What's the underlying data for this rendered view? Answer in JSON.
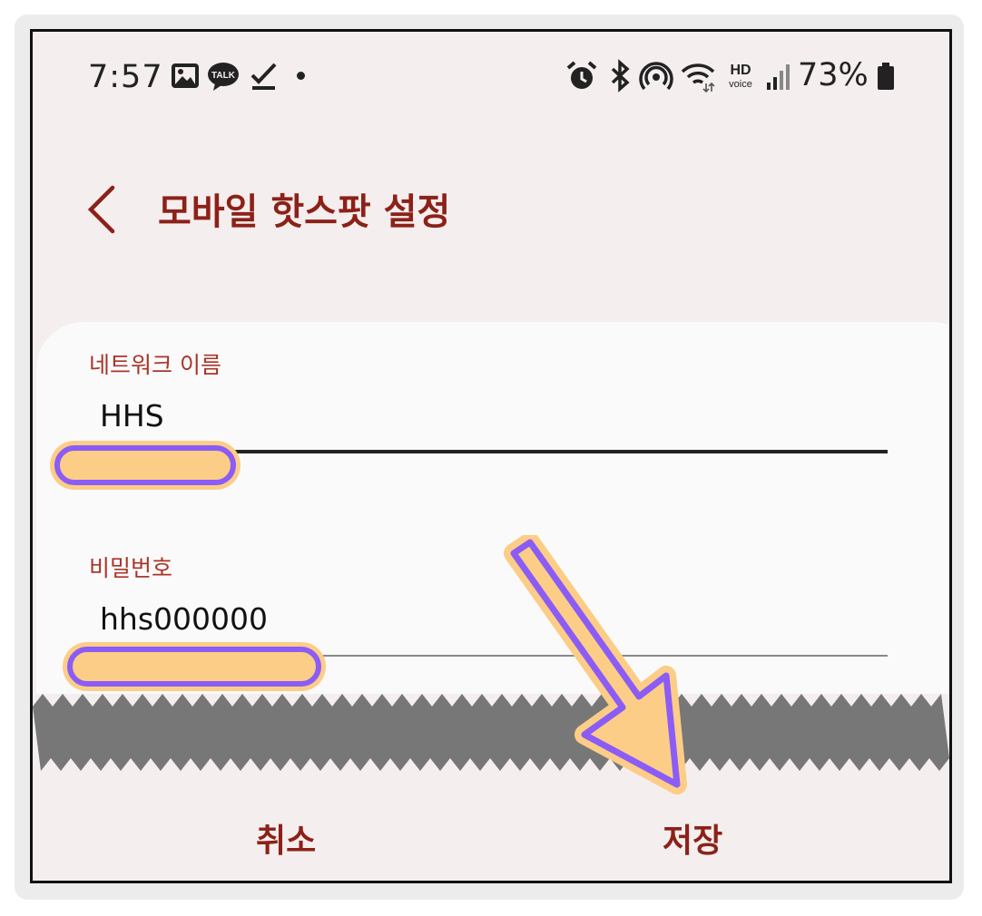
{
  "status_bar": {
    "time": "7:57",
    "notification_icons": [
      "gallery-icon",
      "kakaotalk-icon",
      "task-done-icon",
      "more-notifications-dot"
    ],
    "kakaotalk_text": "TALK",
    "system_icons": [
      "alarm-icon",
      "bluetooth-icon",
      "hotspot-icon",
      "wifi-icon",
      "hd-voice-icon",
      "signal-icon",
      "battery-icon"
    ],
    "hd_text": "HD",
    "voice_text": "voice",
    "battery_percent": "73%"
  },
  "header": {
    "back_icon": "chevron-left-icon",
    "title": "모바일 핫스팟 설정"
  },
  "form": {
    "network_name": {
      "label": "네트워크 이름",
      "value": "HHS"
    },
    "password": {
      "label": "비밀번호",
      "value": "hhs000000"
    }
  },
  "actions": {
    "cancel": "취소",
    "save": "저장"
  },
  "colors": {
    "accent": "#8c2118",
    "label": "#a8352b",
    "highlight_fill": "#fccd86",
    "highlight_border": "#8b5cf6",
    "background": "#f4eeee",
    "torn_strip": "#777777"
  }
}
